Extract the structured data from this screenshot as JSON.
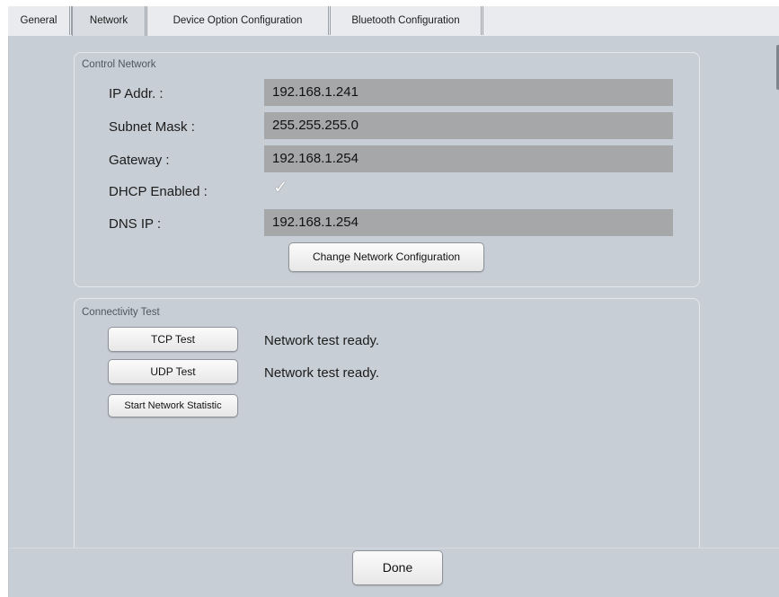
{
  "tabs": [
    {
      "label": "General"
    },
    {
      "label": "Network"
    },
    {
      "label": "Device Option Configuration"
    },
    {
      "label": "Bluetooth Configuration"
    }
  ],
  "control_network": {
    "title": "Control Network",
    "ip_label": "IP Addr. :",
    "ip_value": "192.168.1.241",
    "subnet_label": "Subnet Mask :",
    "subnet_value": "255.255.255.0",
    "gateway_label": "Gateway :",
    "gateway_value": "192.168.1.254",
    "dhcp_label": "DHCP Enabled :",
    "dhcp_checked": true,
    "dns_label": "DNS IP :",
    "dns_value": "192.168.1.254",
    "change_button": "Change Network Configuration"
  },
  "connectivity_test": {
    "title": "Connectivity Test",
    "tcp_button": "TCP Test",
    "tcp_status": "Network test ready.",
    "udp_button": "UDP Test",
    "udp_status": "Network test ready.",
    "stats_button": "Start Network Statistic"
  },
  "footer": {
    "done_button": "Done"
  },
  "colors": {
    "panel_bg": "#c8ced5",
    "field_bg": "#a6a7a8",
    "tab_bg": "#e9ebee"
  },
  "icons": {
    "check": "✓"
  }
}
